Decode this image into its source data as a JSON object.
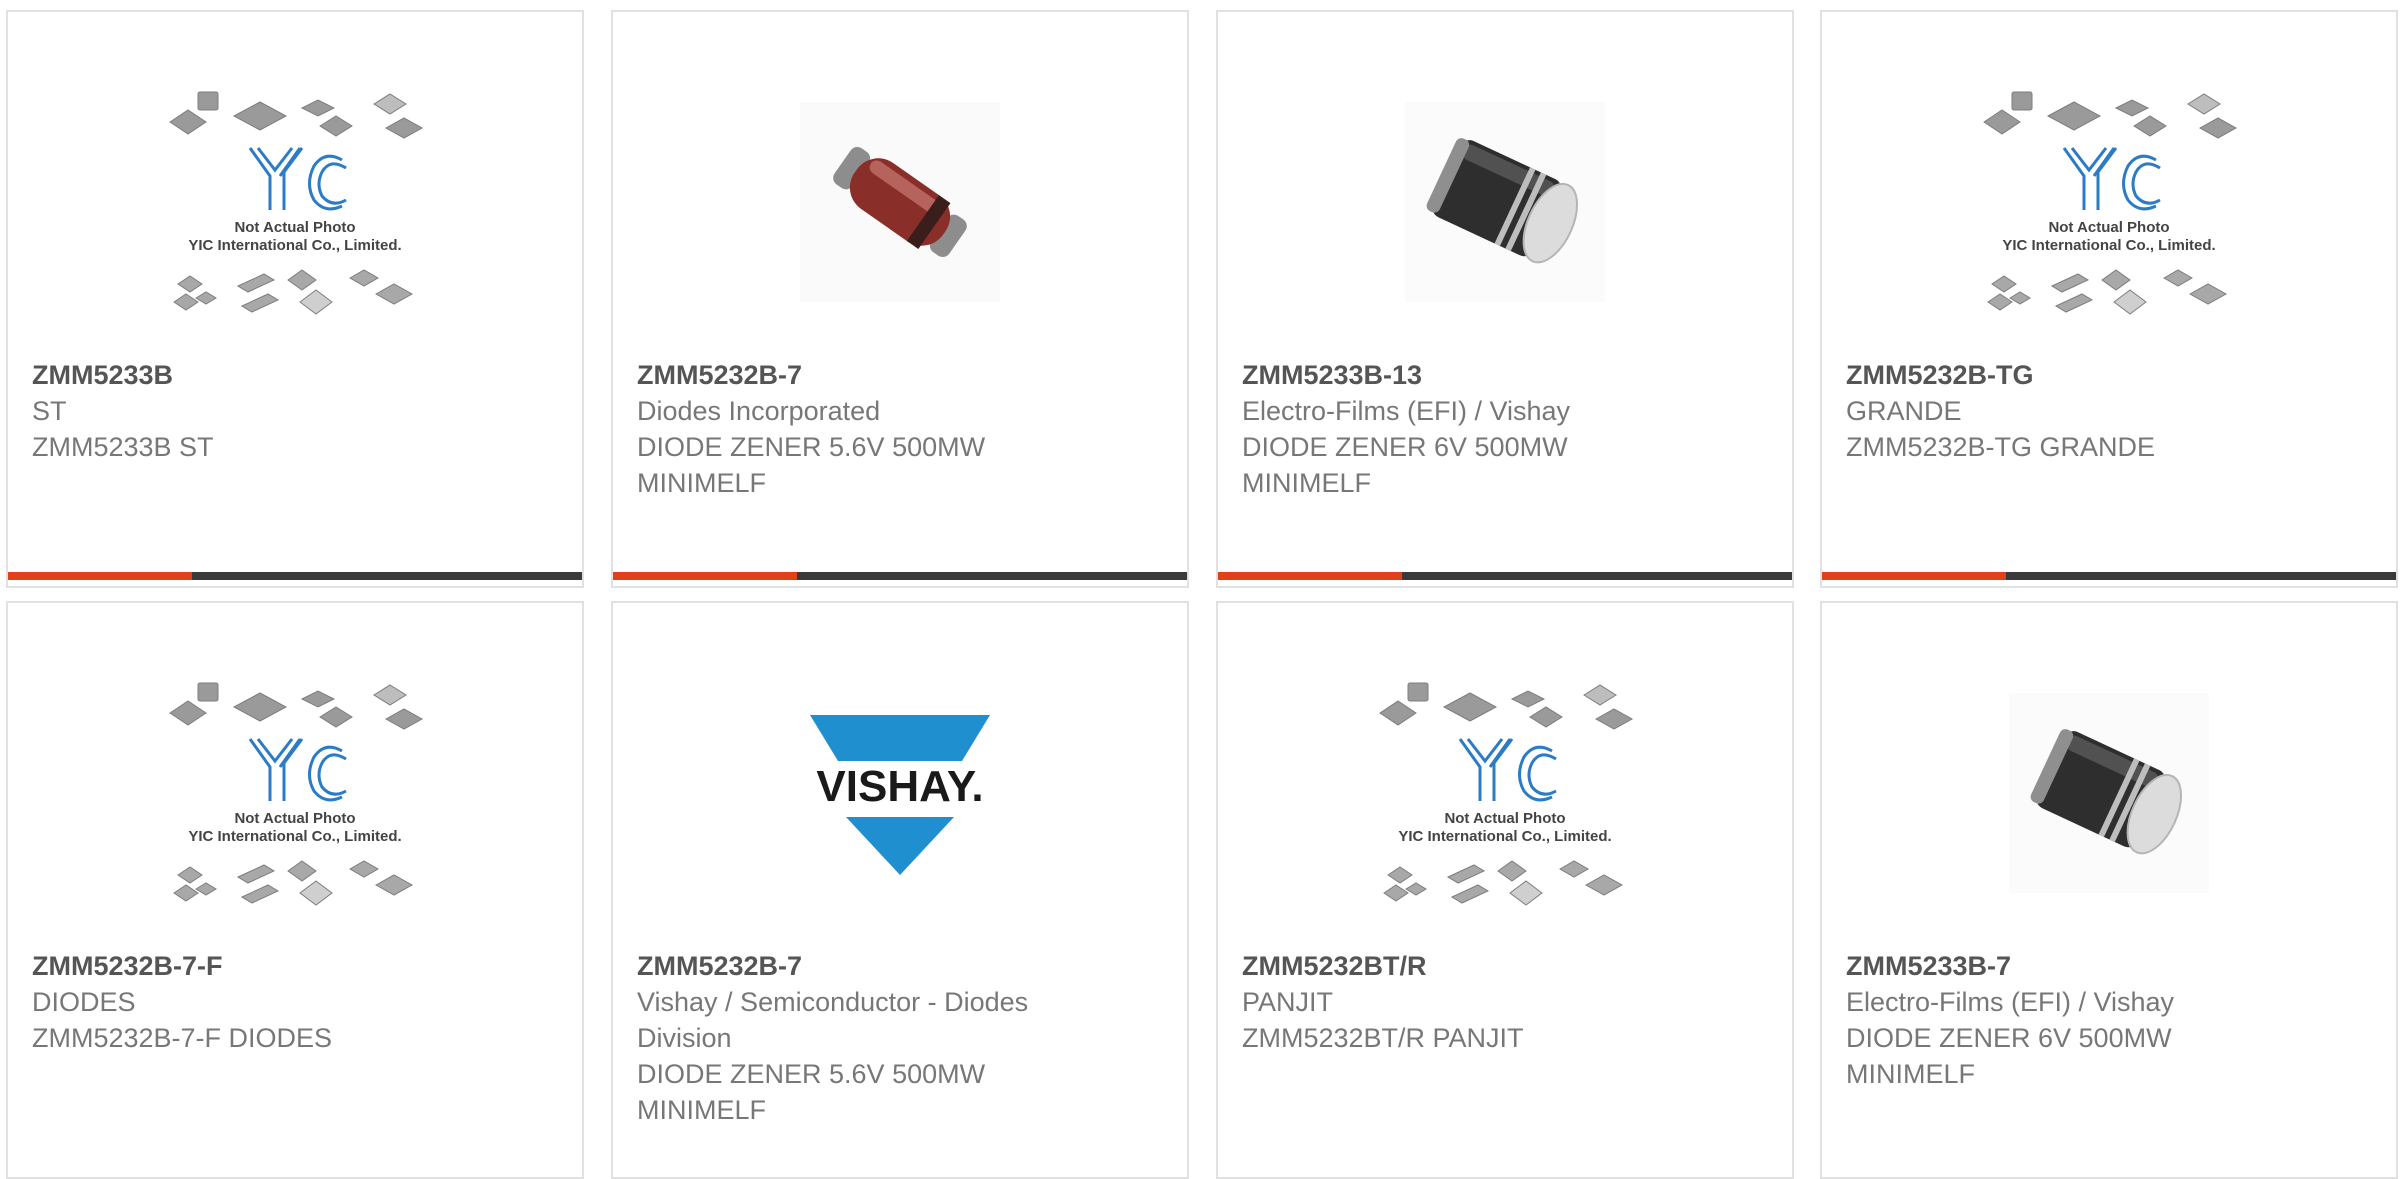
{
  "placeholder": {
    "line1": "Not Actual Photo",
    "line2": "YIC International Co., Limited."
  },
  "vishay_logo": "VISHAY.",
  "colors": {
    "accent": "#e2401c",
    "bar": "#3a3a3a",
    "yic_blue": "#2b7bc6",
    "vishay_blue": "#1f8fcf"
  },
  "products": [
    {
      "pn": "ZMM5233B",
      "lines": [
        "ST",
        "ZMM5233B ST"
      ],
      "image": "yic-placeholder"
    },
    {
      "pn": "ZMM5232B-7",
      "lines": [
        "Diodes Incorporated",
        "DIODE ZENER 5.6V 500MW",
        "MINIMELF"
      ],
      "image": "red-diode"
    },
    {
      "pn": "ZMM5233B-13",
      "lines": [
        "Electro-Films (EFI) / Vishay",
        "DIODE ZENER 6V 500MW",
        "MINIMELF"
      ],
      "image": "black-diode"
    },
    {
      "pn": "ZMM5232B-TG",
      "lines": [
        "GRANDE",
        "ZMM5232B-TG GRANDE"
      ],
      "image": "yic-placeholder"
    },
    {
      "pn": "ZMM5232B-7-F",
      "lines": [
        "DIODES",
        "ZMM5232B-7-F DIODES"
      ],
      "image": "yic-placeholder"
    },
    {
      "pn": "ZMM5232B-7",
      "lines": [
        "Vishay / Semiconductor - Diodes",
        "Division",
        "DIODE ZENER 5.6V 500MW",
        "MINIMELF"
      ],
      "image": "vishay-logo"
    },
    {
      "pn": "ZMM5232BT/R",
      "lines": [
        "PANJIT",
        "ZMM5232BT/R PANJIT"
      ],
      "image": "yic-placeholder"
    },
    {
      "pn": "ZMM5233B-7",
      "lines": [
        "Electro-Films (EFI) / Vishay",
        "DIODE ZENER 6V 500MW",
        "MINIMELF"
      ],
      "image": "black-diode"
    }
  ]
}
